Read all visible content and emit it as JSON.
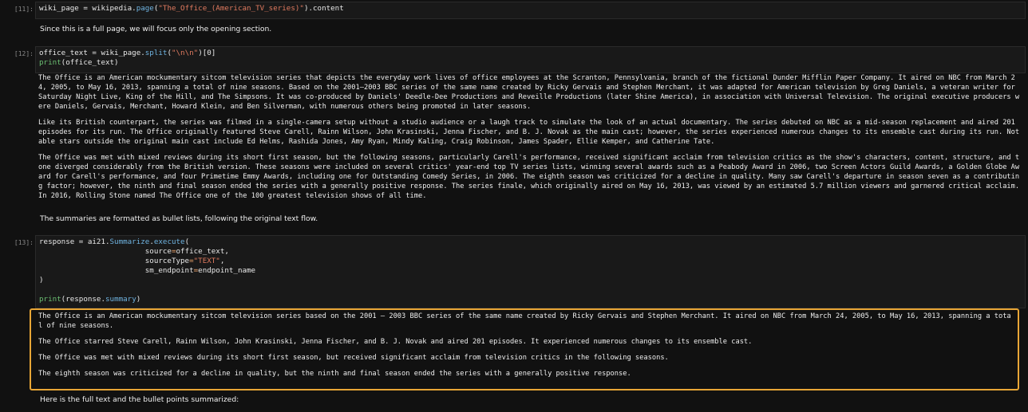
{
  "cells": [
    {
      "prompt": "[11]:",
      "code": [
        "wiki_page = wikipedia.page(\"The_Office_(American_TV_series)\").content"
      ]
    },
    {
      "markdown": "Since this is a full page, we will focus only the opening section."
    },
    {
      "prompt": "[12]:",
      "code": [
        "office_text = wiki_page.split(\"\\n\\n\")[0]",
        "print(office_text)"
      ]
    },
    {
      "output": [
        "The Office is an American mockumentary sitcom television series that depicts the everyday work lives of office employees at the Scranton, Pennsylvania, branch of the fictional Dunder Mifflin Paper Company. It aired on NBC from March 24, 2005, to May 16, 2013, spanning a total of nine seasons. Based on the 2001–2003 BBC series of the same name created by Ricky Gervais and Stephen Merchant, it was adapted for American television by Greg Daniels, a veteran writer for Saturday Night Live, King of the Hill, and The Simpsons. It was co-produced by Daniels' Deedle-Dee Productions and Reveille Productions (later Shine America), in association with Universal Television. The original executive producers were Daniels, Gervais, Merchant, Howard Klein, and Ben Silverman, with numerous others being promoted in later seasons.",
        "Like its British counterpart, the series was filmed in a single-camera setup without a studio audience or a laugh track to simulate the look of an actual documentary. The series debuted on NBC as a mid-season replacement and aired 201 episodes for its run. The Office originally featured Steve Carell, Rainn Wilson, John Krasinski, Jenna Fischer, and B. J. Novak as the main cast; however, the series experienced numerous changes to its ensemble cast during its run. Notable stars outside the original main cast include Ed Helms, Rashida Jones, Amy Ryan, Mindy Kaling, Craig Robinson, James Spader, Ellie Kemper, and Catherine Tate.",
        "The Office was met with mixed reviews during its short first season, but the following seasons, particularly Carell's performance, received significant acclaim from television critics as the show's characters, content, structure, and tone diverged considerably from the British version. These seasons were included on several critics' year-end top TV series lists, winning several awards such as a Peabody Award in 2006, two Screen Actors Guild Awards, a Golden Globe Award for Carell's performance, and four Primetime Emmy Awards, including one for Outstanding Comedy Series, in 2006. The eighth season was criticized for a decline in quality. Many saw Carell's departure in season seven as a contributing factor; however, the ninth and final season ended the series with a generally positive response. The series finale, which originally aired on May 16, 2013, was viewed by an estimated 5.7 million viewers and garnered critical acclaim. In 2016, Rolling Stone named The Office one of the 100 greatest television shows of all time."
      ]
    },
    {
      "markdown": "The summaries are formatted as bullet lists, following the original text flow."
    },
    {
      "prompt": "[13]:"
    },
    {
      "output": [
        "The Office is an American mockumentary sitcom television series based on the 2001 – 2003 BBC series of the same name created by Ricky Gervais and Stephen Merchant. It aired on NBC from March 24, 2005, to May 16, 2013, spanning a total of nine seasons.",
        "The Office starred Steve Carell, Rainn Wilson, John Krasinski, Jenna Fischer, and B. J. Novak and aired 201 episodes. It experienced numerous changes to its ensemble cast.",
        "The Office was met with mixed reviews during its short first season, but received significant acclaim from television critics in the following seasons.",
        "The eighth season was criticized for a decline in quality, but the ninth and final season ended the series with a generally positive response."
      ]
    },
    {
      "markdown": "Here is the full text and the bullet points summarized:"
    }
  ],
  "code13": {
    "line1_a": "response = ai21.",
    "line1_b": "Summarize",
    "line1_c": ".",
    "line1_d": "execute",
    "line1_e": "(",
    "line2_a": "                        source",
    "line2_b": "=",
    "line2_c": "office_text,",
    "line3_a": "                        sourceType",
    "line3_b": "=",
    "line3_c": "\"TEXT\"",
    "line3_d": ",",
    "line4_a": "                        sm_endpoint",
    "line4_b": "=",
    "line4_c": "endpoint_name",
    "line5": ")",
    "line6_a": "print",
    "line6_b": "(response.",
    "line6_c": "summary",
    "line6_d": ")"
  },
  "code11": {
    "a": "wiki_page = wikipedia.",
    "b": "page",
    "c": "(",
    "d": "\"The_Office_(American_TV_series)\"",
    "e": ").content"
  },
  "code12": {
    "l1a": "office_text = wiki_page.",
    "l1b": "split",
    "l1c": "(",
    "l1d": "\"\\n\\n\"",
    "l1e": ")[0]",
    "l2a": "print",
    "l2b": "(office_text)"
  },
  "highlight_color": "#e8a636"
}
